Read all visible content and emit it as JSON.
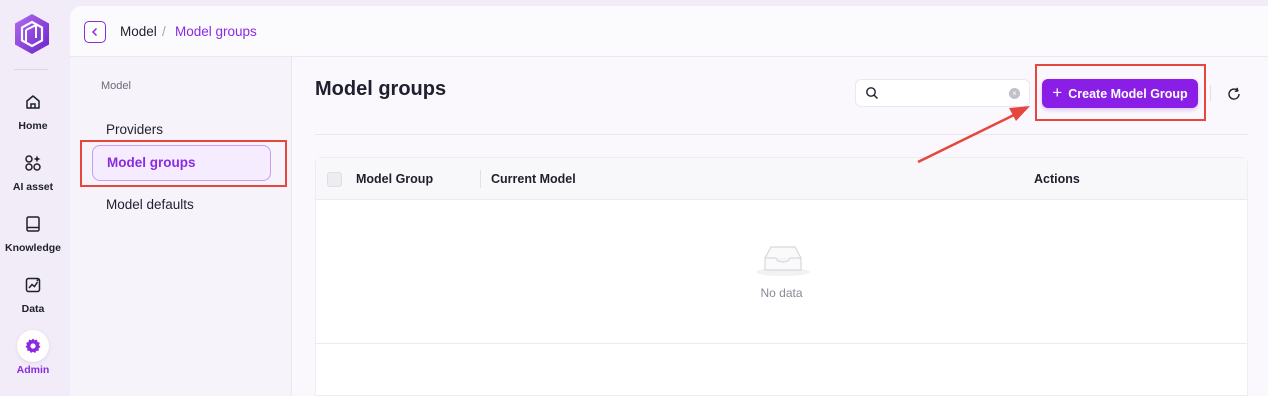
{
  "rail": {
    "items": [
      {
        "label": "Home",
        "icon": "home-icon"
      },
      {
        "label": "AI asset",
        "icon": "ai-asset-icon"
      },
      {
        "label": "Knowledge",
        "icon": "book-icon"
      },
      {
        "label": "Data",
        "icon": "chart-icon"
      },
      {
        "label": "Admin",
        "icon": "gear-icon",
        "active": true
      }
    ]
  },
  "breadcrumb": {
    "items": [
      "Model",
      "/",
      "Model groups"
    ]
  },
  "subnav": {
    "title": "Model",
    "items": [
      {
        "label": "Providers"
      },
      {
        "label": "Model groups",
        "active": true
      },
      {
        "label": "Model defaults"
      }
    ]
  },
  "main": {
    "title": "Model groups",
    "search": {
      "value": "",
      "placeholder": ""
    },
    "create_button": "Create Model Group"
  },
  "table": {
    "columns": [
      "Model Group",
      "Current Model",
      "Actions"
    ],
    "rows": [],
    "empty_text": "No data"
  },
  "colors": {
    "accent": "#8a1ee6",
    "highlight": "#e5473f"
  }
}
